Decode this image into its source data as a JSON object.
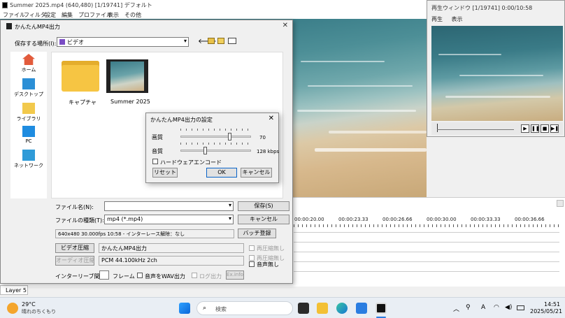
{
  "app": {
    "title": "Summer 2025.mp4 (640,480)  [1/19741]  デフォルト",
    "menu": [
      "ファイル",
      "フィルタ",
      "設定",
      "編集",
      "プロファイル",
      "表示",
      "その他"
    ]
  },
  "preview": {
    "title": "再生ウィンドウ  [1/19741]  0:00/10:58",
    "menu": [
      "再生",
      "表示"
    ]
  },
  "timeline": {
    "ruler": [
      "00:00:20.00",
      "00:00:23.33",
      "00:00:26.66",
      "00:00:30.00",
      "00:00:33.33",
      "00:00:36.66"
    ],
    "layer_label": "Layer 5"
  },
  "export_dialog": {
    "title": "かんたんMP4出力",
    "save_location_label": "保存する場所(I):",
    "save_location_value": "ビデオ",
    "places": [
      "ホーム",
      "デスクトップ",
      "ライブラリ",
      "PC",
      "ネットワーク"
    ],
    "files": [
      "キャプチャ",
      "Summer 2025"
    ],
    "filename_label": "ファイル名(N):",
    "filename_value": "",
    "filetype_label": "ファイルの種類(T):",
    "filetype_value": "mp4 (*.mp4)",
    "save_button": "保存(S)",
    "cancel_button": "キャンセル",
    "info": "640x480  30.000fps  10:58  -  インターレース解除：なし",
    "batch_button": "バッチ登録",
    "video_compress_button": "ビデオ圧縮",
    "video_codec": "かんたんMP4出力",
    "audio_compress_button": "オーディオ圧縮",
    "audio_codec": "PCM 44.100kHz 2ch",
    "no_recompress_video": "再圧縮無し",
    "no_recompress_audio": "再圧縮無し",
    "no_audio": "音声無し",
    "interleave_label": "インターリーブ間隔：",
    "interleave_unit": "フレーム",
    "wav_output": "音声をWAV出力",
    "log_output": "ログ出力",
    "exinfo_button": "Ex.info"
  },
  "settings_dialog": {
    "title": "かんたんMP4出力の設定",
    "quality_label": "画質",
    "quality_value": "70",
    "quality_fraction": 0.7,
    "audio_label": "音質",
    "audio_value": "128 kbps",
    "audio_fraction": 0.35,
    "hw_encode_label": "ハードウェアエンコード",
    "reset_button": "リセット",
    "ok_button": "OK",
    "cancel_button": "キャンセル"
  },
  "taskbar": {
    "temperature": "29°C",
    "weather": "晴れのちくもり",
    "search_placeholder": "検索",
    "time": "14:51",
    "date": "2025/05/21",
    "ime": "A"
  }
}
